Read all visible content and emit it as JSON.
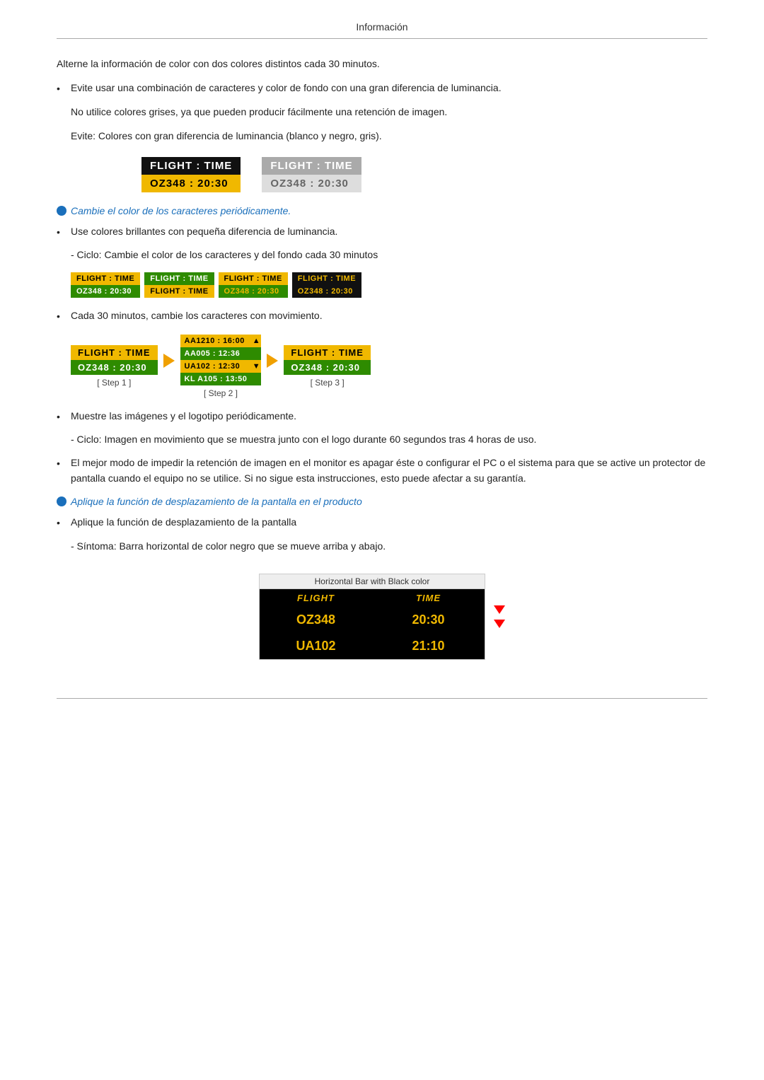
{
  "page": {
    "title": "Información"
  },
  "content": {
    "intro_text": "Alterne la información de color con dos colores distintos cada 30 minutos.",
    "bullet1": "Evite usar una combinación de caracteres y color de fondo con una gran diferencia de luminancia.",
    "para1": "No utilice colores grises, ya que pueden producir fácilmente una retención de imagen.",
    "para2": "Evite: Colores con gran diferencia de luminancia (blanco y negro, gris).",
    "flight_dark_header": "FLIGHT  :  TIME",
    "flight_dark_data": "OZ348   :  20:30",
    "flight_grey_header": "FLIGHT  :  TIME",
    "flight_grey_data": "OZ348   :  20:30",
    "italic_blue": "Cambie el color de los caracteres periódicamente.",
    "bullet2": "Use colores brillantes con pequeña diferencia de luminancia.",
    "sub1": "- Ciclo: Cambie el color de los caracteres y del fondo cada 30 minutos",
    "bullet3": "Cada 30 minutos, cambie los caracteres con movimiento.",
    "step1_label": "[ Step 1 ]",
    "step2_label": "[ Step 2 ]",
    "step3_label": "[ Step 3 ]",
    "step1_header": "FLIGHT  :  TIME",
    "step1_data": "OZ348   :  20:30",
    "step3_header": "FLIGHT  :  TIME",
    "step3_data": "OZ348   :  20:30",
    "bullet4": "Muestre las imágenes y el logotipo periódicamente.",
    "sub2": "- Ciclo: Imagen en movimiento que se muestra junto con el logo durante 60 segundos tras 4 horas de uso.",
    "bullet5": "El mejor modo de impedir la retención de imagen en el monitor es apagar éste o configurar el PC o el sistema para que se active un protector de pantalla cuando el equipo no se utilice. Si no sigue esta instrucciones, esto puede afectar a su garantía.",
    "italic_blue2": "Aplique la función de desplazamiento de la pantalla en el producto",
    "bullet6": "Aplique la función de desplazamiento de la pantalla",
    "sub3": "- Síntoma: Barra horizontal de color negro que se mueve arriba y abajo.",
    "hbar_title": "Horizontal Bar with Black color",
    "hbar_h1": "FLIGHT",
    "hbar_h2": "TIME",
    "hbar_r1c1": "OZ348",
    "hbar_r1c2": "20:30",
    "hbar_r2c1": "UA102",
    "hbar_r2c2": "21:10",
    "mini_boxes": [
      {
        "h": "FLIGHT  :  TIME",
        "d": "OZ348  :  20:30",
        "class": "mb1"
      },
      {
        "h": "FLIGHT  :  TIME",
        "d": "FLIGHT  :  TIME",
        "class": "mb2"
      },
      {
        "h": "FLIGHT  :  TIME",
        "d": "OZ348  :  20:30",
        "class": "mb3"
      },
      {
        "h": "FLIGHT  :  TIME",
        "d": "OZ348  :  20:30",
        "class": "mb4"
      }
    ]
  }
}
